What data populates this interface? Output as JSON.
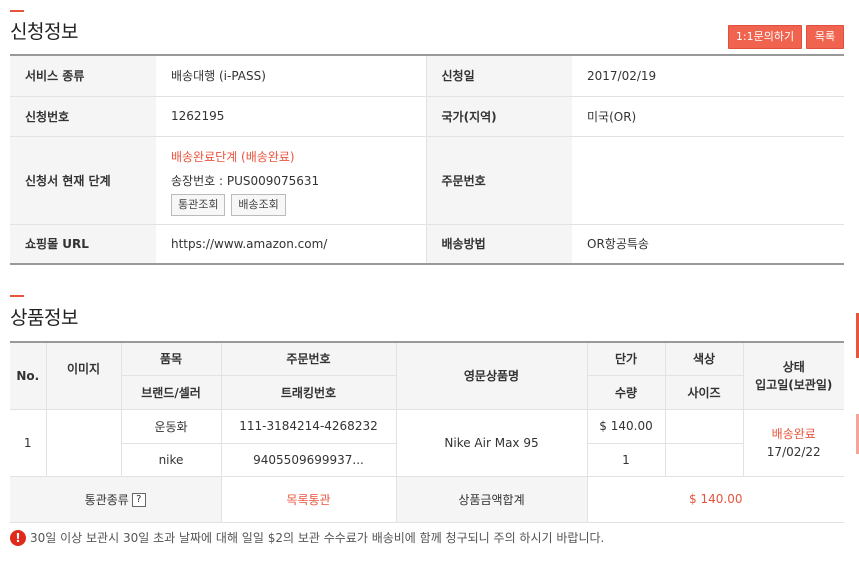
{
  "application_info": {
    "title": "신청정보",
    "buttons": {
      "inquiry": "1:1문의하기",
      "list": "목록"
    },
    "rows": [
      {
        "label1": "서비스 종류",
        "value1": "배송대행 (i-PASS)",
        "label2": "신청일",
        "value2": "2017/02/19"
      },
      {
        "label1": "신청번호",
        "value1": "1262195",
        "label2": "국가(지역)",
        "value2": "미국(OR)"
      },
      {
        "label1": "신청서 현재 단계",
        "label2": "주문번호",
        "value2": ""
      },
      {
        "label1": "쇼핑몰 URL",
        "value1": "https://www.amazon.com/",
        "label2": "배송방법",
        "value2": "OR항공특송"
      }
    ],
    "stage": {
      "status": "배송완료단계 (배송완료)",
      "tracking": "송장번호 : PUS009075631",
      "customs_btn": "통관조회",
      "delivery_btn": "배송조회"
    }
  },
  "product_info": {
    "title": "상품정보",
    "headers": {
      "no": "No.",
      "image": "이미지",
      "item": "품목",
      "order_no": "주문번호",
      "english_name": "영문상품명",
      "unit_price": "단가",
      "color": "색상",
      "status": "상태",
      "brand": "브랜드/셀러",
      "tracking_no": "트래킹번호",
      "qty": "수량",
      "size": "사이즈",
      "received": "입고일(보관일)"
    },
    "row": {
      "no": "1",
      "image": "",
      "item": "운동화",
      "order_no": "111-3184214-4268232",
      "english_name": "Nike Air Max 95",
      "unit_price": "$ 140.00",
      "color": "",
      "status": "배송완료",
      "brand": "nike",
      "tracking_no": "9405509699937...",
      "qty": "1",
      "size": "",
      "received_date": "17/02/22"
    },
    "footer": {
      "customs_type_label": "통관종류",
      "customs_type_help": "?",
      "customs_type_value": "목록통관",
      "total_label": "상품금액합계",
      "total_value": "$ 140.00"
    }
  },
  "notice": {
    "icon": "!",
    "text": "30일 이상 보관시 30일 초과 날짜에 대해 일일 $2의 보관 수수료가 배송비에 함께 청구되니 주의 하시기 바랍니다."
  }
}
